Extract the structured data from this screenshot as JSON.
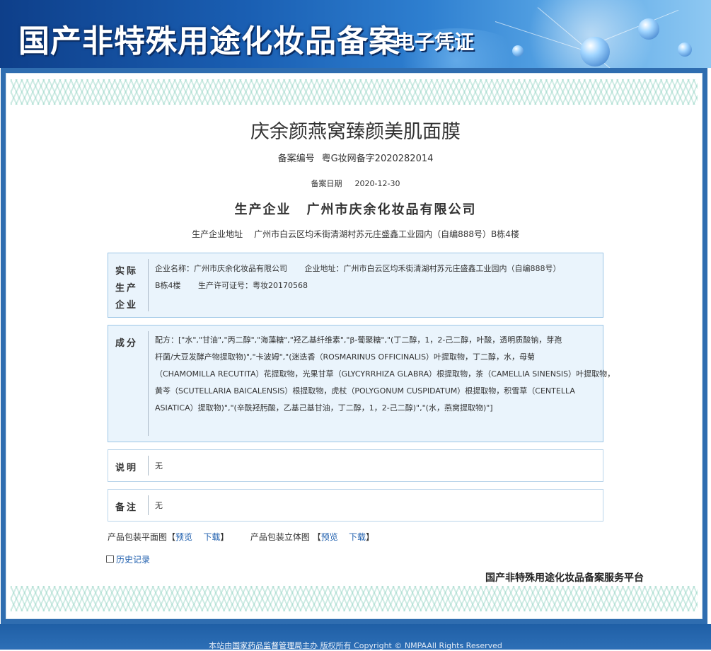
{
  "banner": {
    "title": "国产非特殊用途化妆品备案",
    "subtitle": "电子凭证"
  },
  "product": {
    "name": "庆余颜燕窝臻颜美肌面膜",
    "record_no_label": "备案编号",
    "record_no": "粤G妆网备字2020282014",
    "record_date_label": "备案日期",
    "record_date": "2020-12-30",
    "producer_label": "生产企业",
    "producer": "广州市庆余化妆品有限公司",
    "address_label": "生产企业地址",
    "address": "广州市白云区均禾街清湖村苏元庄盛鑫工业园内（自编888号）B栋4楼"
  },
  "sections": {
    "actual_producer": {
      "label": "实际生产企业",
      "label_lines": [
        "实际",
        "生产",
        "企业"
      ],
      "line1": "企业名称：广州市庆余化妆品有限公司       企业地址：广州市白云区均禾街清湖村苏元庄盛鑫工业园内（自编888号）",
      "line2": "B栋4楼       生产许可证号：粤妆20170568"
    },
    "ingredients": {
      "label": "成分",
      "lines": [
        "配方：[\"水\",\"甘油\",\"丙二醇\",\"海藻糖\",\"羟乙基纤维素\",\"β-葡聚糖\",\"(丁二醇，1，2-己二醇，叶酸，透明质酸钠，芽孢",
        "杆菌/大豆发酵产物提取物)\",\"卡波姆\",\"(迷迭香（ROSMARINUS OFFICINALIS）叶提取物，丁二醇，水，母菊",
        "（CHAMOMILLA RECUTITA）花提取物，光果甘草（GLYCYRRHIZA GLABRA）根提取物，茶（CAMELLIA SINENSIS）叶提取物，",
        "黄芩（SCUTELLARIA BAICALENSIS）根提取物，虎杖（POLYGONUM CUSPIDATUM）根提取物，积雪草（CENTELLA",
        "ASIATICA）提取物)\",\"(辛酰羟肟酸，乙基己基甘油，丁二醇，1，2-己二醇)\",\"(水，燕窝提取物)\"]"
      ]
    },
    "note": {
      "label": "说明",
      "value": "无"
    },
    "remark": {
      "label": "备注",
      "value": "无"
    }
  },
  "links": {
    "flat_label": "产品包装平面图",
    "flat_preview": "预览",
    "flat_download": "下载",
    "stereo_label": "产品包装立体图",
    "stereo_preview": "预览",
    "stereo_download": "下载",
    "bracket_open": "【",
    "bracket_close": "】"
  },
  "history": {
    "label": "历史记录"
  },
  "platform_name": "国产非特殊用途化妆品备案服务平台",
  "footer": {
    "prefix": "本站由",
    "authority": "国家药品监督管理局",
    "suffix": "主办 版权所有 Copyright © NMPAAll Rights Reserved"
  },
  "colors": {
    "banner": "#1a5fb3",
    "frame": "#2f6db0",
    "box_bg": "#eaf4fc",
    "link": "#1f5fae"
  }
}
